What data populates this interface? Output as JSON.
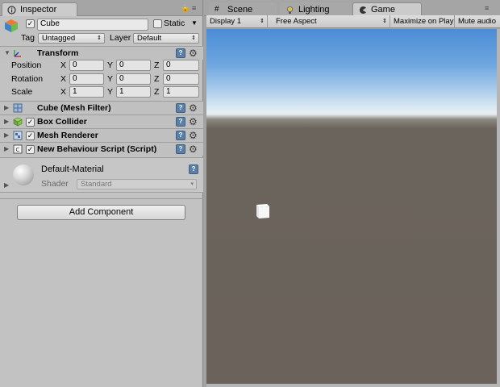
{
  "inspector": {
    "tab_label": "Inspector",
    "object": {
      "active": true,
      "name": "Cube",
      "static_label": "Static",
      "static_checked": false
    },
    "tag_label": "Tag",
    "tag_value": "Untagged",
    "layer_label": "Layer",
    "layer_value": "Default",
    "transform": {
      "title": "Transform",
      "rows": [
        {
          "label": "Position",
          "x": "0",
          "y": "0",
          "z": "0"
        },
        {
          "label": "Rotation",
          "x": "0",
          "y": "0",
          "z": "0"
        },
        {
          "label": "Scale",
          "x": "1",
          "y": "1",
          "z": "1"
        }
      ],
      "axis_x": "X",
      "axis_y": "Y",
      "axis_z": "Z"
    },
    "components": [
      {
        "name": "Cube (Mesh Filter)",
        "checkbox": false
      },
      {
        "name": "Box Collider",
        "checkbox": true
      },
      {
        "name": "Mesh Renderer",
        "checkbox": true
      },
      {
        "name": "New Behaviour Script (Script)",
        "checkbox": true
      }
    ],
    "material": {
      "name": "Default-Material",
      "shader_label": "Shader",
      "shader_value": "Standard"
    },
    "add_component_label": "Add Component"
  },
  "right_tabs": [
    {
      "label": "Scene",
      "icon": "grid-icon"
    },
    {
      "label": "Lighting",
      "icon": "bulb-icon"
    },
    {
      "label": "Game",
      "icon": "pacman-icon"
    }
  ],
  "game_toolbar": {
    "display": "Display 1",
    "aspect": "Free Aspect",
    "maximize": "Maximize on Play",
    "mute": "Mute audio"
  },
  "colors": {
    "panel": "#c2c2c2",
    "sky_top": "#4b8cd6",
    "ground": "#6a625b",
    "help_icon": "#5c7fa6"
  }
}
